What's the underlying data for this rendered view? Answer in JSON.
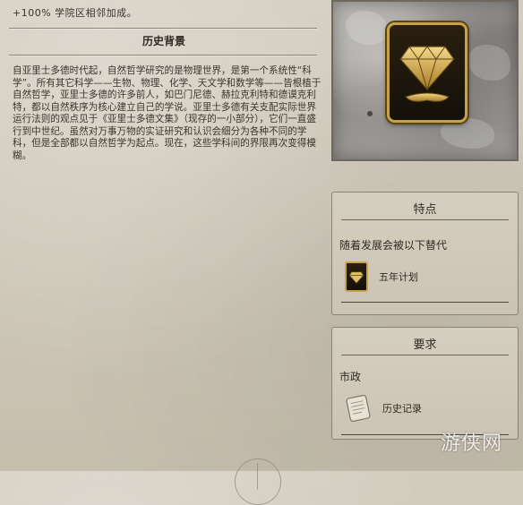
{
  "bonus_line": "+100% 学院区相邻加成。",
  "history": {
    "heading": "历史背景",
    "body": "自亚里士多德时代起，自然哲学研究的是物理世界，是第一个系统性“科学”。所有其它科学——生物、物理、化学、天文学和数学等——皆根植于自然哲学，亚里士多德的许多前人，如巴门尼德、赫拉克利特和德谟克利特，都以自然秩序为核心建立自己的学说。亚里士多德有关支配实际世界运行法则的观点见于《亚里士多德文集》（现存的一小部分），它们一直盛行到中世纪。虽然对万事万物的实证研究和认识会细分为各种不同的学科，但是全部都以自然哲学为起点。现在，这些学科间的界限再次变得模糊。"
  },
  "portrait": {
    "icon": "diamond-tech-icon",
    "accent_color": "#c8a046"
  },
  "traits": {
    "header": "特点",
    "subtitle": "随着发展会被以下替代",
    "items": [
      {
        "label": "五年计划",
        "icon": "diamond-tech-icon"
      }
    ]
  },
  "requirements": {
    "header": "要求",
    "subtitle": "市政",
    "items": [
      {
        "label": "历史记录",
        "icon": "scroll-icon"
      }
    ]
  },
  "watermark": "游侠网"
}
